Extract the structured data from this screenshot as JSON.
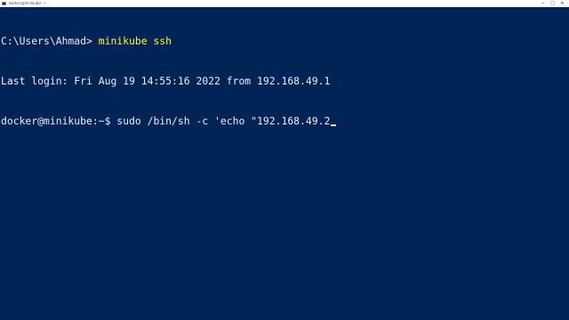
{
  "window": {
    "title": "docker@minikube: ~",
    "controls": {
      "minimize": "─",
      "maximize": "□",
      "close": "✕"
    }
  },
  "terminal": {
    "line1": {
      "prompt": "C:\\Users\\Ahmad> ",
      "command": "minikube ssh"
    },
    "line2": "Last login: Fri Aug 19 14:55:16 2022 from 192.168.49.1",
    "line3": "docker@minikube:~$ sudo /bin/sh -c 'echo \"192.168.49.2"
  },
  "colors": {
    "background": "#012456",
    "text": "#eeedf0",
    "command": "#ffff00"
  }
}
